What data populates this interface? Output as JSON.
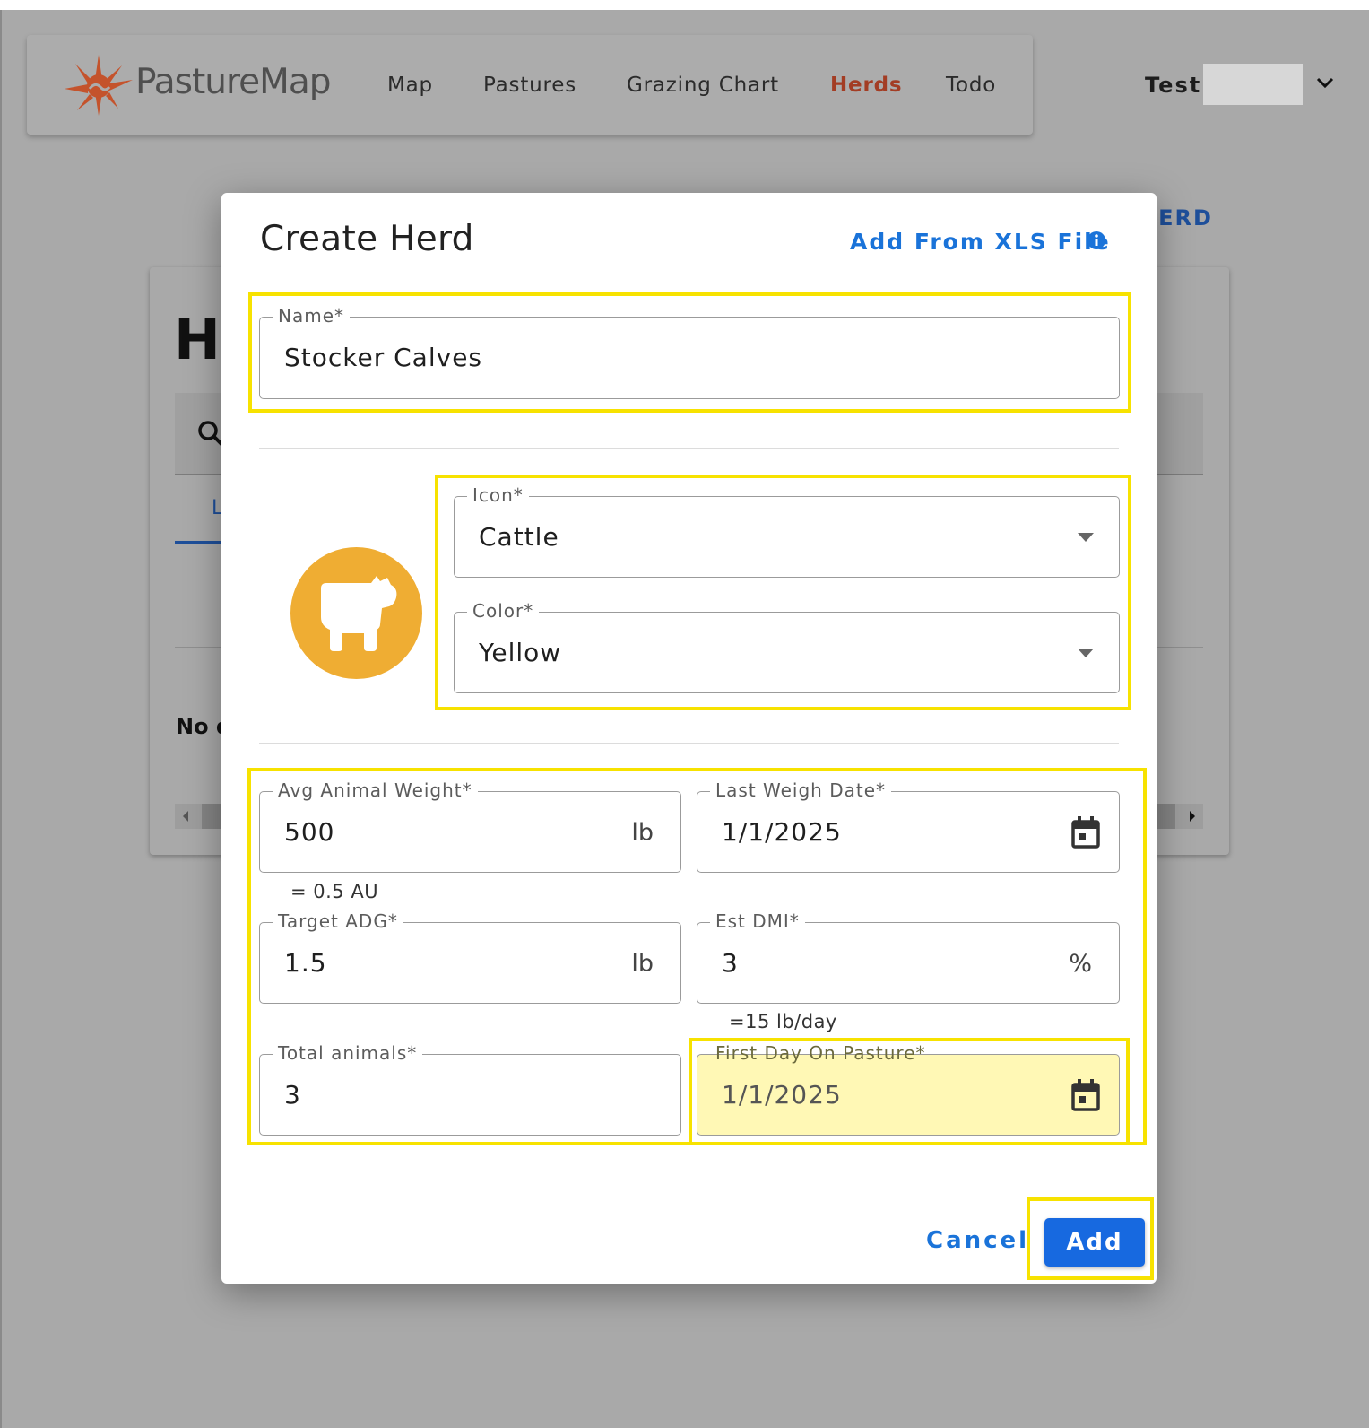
{
  "app": {
    "brand": "PastureMap",
    "nav": [
      {
        "label": "Map",
        "active": false
      },
      {
        "label": "Pastures",
        "active": false
      },
      {
        "label": "Grazing Chart",
        "active": false
      },
      {
        "label": "Herds",
        "active": true
      },
      {
        "label": "Todo",
        "active": false
      }
    ],
    "user": {
      "name": "Test"
    }
  },
  "background": {
    "add_herd_link": "HERD",
    "page_title": "H",
    "tab_label": "L",
    "empty_text": "No d"
  },
  "dialog": {
    "title": "Create Herd",
    "xls_link": "Add From XLS File",
    "name": {
      "label": "Name*",
      "value": "Stocker Calves"
    },
    "icon_field": {
      "label": "Icon*",
      "value": "Cattle"
    },
    "color_field": {
      "label": "Color*",
      "value": "Yellow"
    },
    "avg_weight": {
      "label": "Avg Animal Weight*",
      "value": "500",
      "unit": "lb",
      "helper": "= 0.5 AU"
    },
    "last_weigh_date": {
      "label": "Last Weigh Date*",
      "value": "1/1/2025"
    },
    "target_adg": {
      "label": "Target ADG*",
      "value": "1.5",
      "unit": "lb"
    },
    "est_dmi": {
      "label": "Est DMI*",
      "value": "3",
      "unit": "%",
      "helper": "=15 lb/day"
    },
    "total_animals": {
      "label": "Total animals*",
      "value": "3"
    },
    "first_day": {
      "label": "First Day On Pasture*",
      "value": "1/1/2025"
    },
    "cancel": "Cancel",
    "add": "Add"
  },
  "colors": {
    "accent": "#1a73d9",
    "herd_icon": "#efad33",
    "highlight": "#f7e200",
    "nav_active": "#a33d24"
  },
  "icons": [
    "compass-logo-icon",
    "chevron-down-icon",
    "search-icon",
    "info-icon",
    "cow-icon",
    "dropdown-caret-icon",
    "calendar-icon"
  ]
}
